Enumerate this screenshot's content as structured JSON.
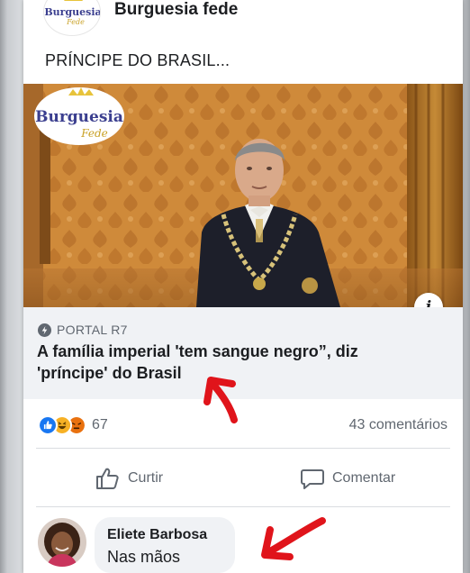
{
  "post": {
    "page_name": "Burguesia fede",
    "text": "PRÍNCIPE DO BRASIL...",
    "logo": {
      "line1": "Burguesia",
      "line2": "Fede"
    },
    "image_logo": {
      "line1": "Burguesia",
      "line2": "Fede"
    },
    "info_icon": "i"
  },
  "link": {
    "source": "PORTAL R7",
    "headline": "A família imperial 'tem sangue negro”, diz 'príncipe' do Brasil"
  },
  "stats": {
    "reaction_count": "67",
    "reaction_icons": [
      "like-icon",
      "haha-icon",
      "angry-icon"
    ],
    "comments": "43 comentários"
  },
  "actions": {
    "like_label": "Curtir",
    "comment_label": "Comentar"
  },
  "comment": {
    "author": "Eliete Barbosa",
    "text": "Nas mãos"
  },
  "colors": {
    "like_blue": "#1877f2",
    "haha_yellow": "#f7b125",
    "angry_orange": "#e9710f",
    "annotation_red": "#e0141b"
  }
}
